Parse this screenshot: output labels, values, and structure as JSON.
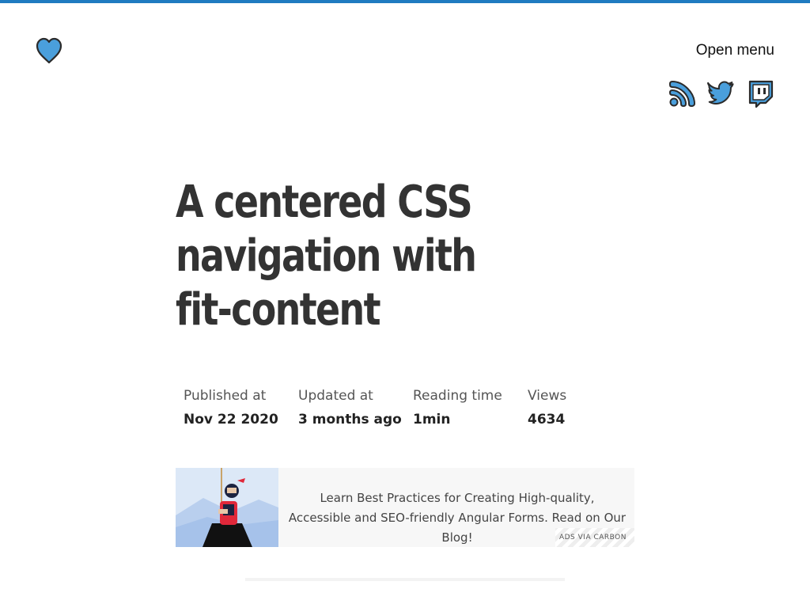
{
  "header": {
    "logo_icon": "heart-icon",
    "menu_label": "Open menu",
    "social": [
      {
        "icon": "rss-icon"
      },
      {
        "icon": "twitter-icon"
      },
      {
        "icon": "twitch-icon"
      }
    ]
  },
  "colors": {
    "accent": "#1f7bc1",
    "icon_fill": "#4a9fdc",
    "title": "#333333"
  },
  "article": {
    "title": "A centered CSS navigation with fit-content",
    "meta": [
      {
        "label": "Published at",
        "value": "Nov 22 2020"
      },
      {
        "label": "Updated at",
        "value": "3 months ago"
      },
      {
        "label": "Reading time",
        "value": "1min"
      },
      {
        "label": "Views",
        "value": "4634"
      }
    ]
  },
  "ad": {
    "text": "Learn Best Practices for Creating High-quality, Accessible and SEO-friendly Angular Forms. Read on Our Blog!",
    "via": "ADS VIA CARBON"
  }
}
